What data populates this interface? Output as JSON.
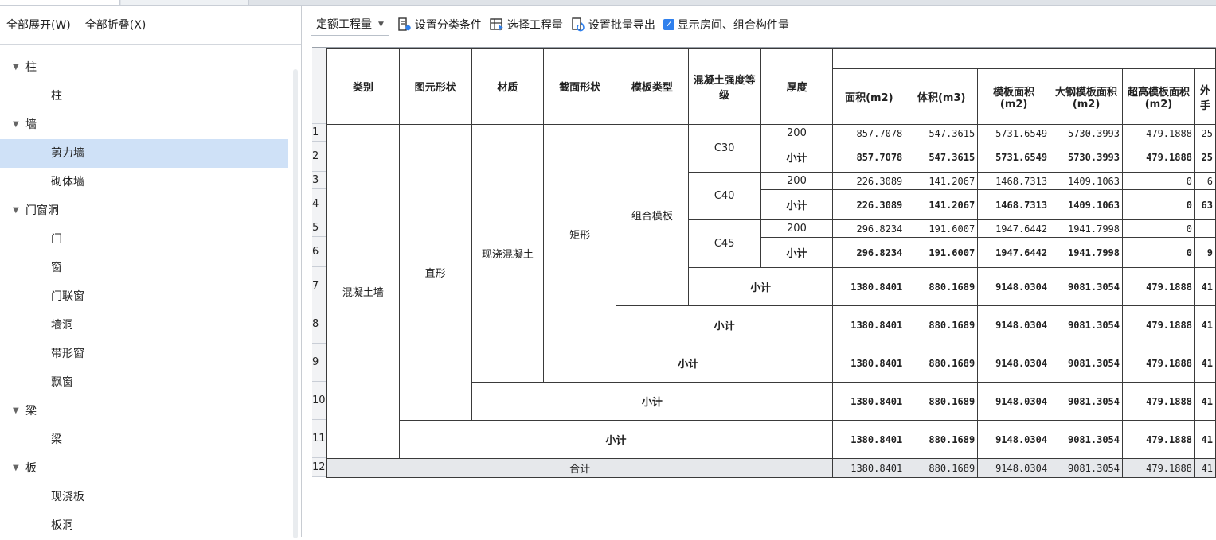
{
  "left_toolbar": {
    "expand_all": "全部展开(W)",
    "collapse_all": "全部折叠(X)"
  },
  "tree": [
    {
      "type": "group",
      "label": "柱"
    },
    {
      "type": "leaf",
      "label": "柱"
    },
    {
      "type": "group",
      "label": "墙"
    },
    {
      "type": "leaf",
      "label": "剪力墙",
      "selected": true
    },
    {
      "type": "leaf",
      "label": "砌体墙"
    },
    {
      "type": "group",
      "label": "门窗洞"
    },
    {
      "type": "leaf",
      "label": "门"
    },
    {
      "type": "leaf",
      "label": "窗"
    },
    {
      "type": "leaf",
      "label": "门联窗"
    },
    {
      "type": "leaf",
      "label": "墙洞"
    },
    {
      "type": "leaf",
      "label": "带形窗"
    },
    {
      "type": "leaf",
      "label": "飘窗"
    },
    {
      "type": "group",
      "label": "梁"
    },
    {
      "type": "leaf",
      "label": "梁"
    },
    {
      "type": "group",
      "label": "板"
    },
    {
      "type": "leaf",
      "label": "现浇板"
    },
    {
      "type": "leaf",
      "label": "板洞"
    }
  ],
  "toolbar": {
    "dropdown_value": "定额工程量",
    "set_classify": "设置分类条件",
    "select_qty": "选择工程量",
    "batch_export": "设置批量导出",
    "show_room": "显示房间、组合构件量",
    "show_room_checked": true
  },
  "table": {
    "headers": {
      "category": "类别",
      "shape": "图元形状",
      "material": "材质",
      "section": "截面形状",
      "formwork": "模板类型",
      "grade": "混凝土强度等级",
      "thickness": "厚度",
      "area": "面积(m2)",
      "volume": "体积(m3)",
      "form_area": "模板面积(m2)",
      "steel_form": "大钢模板面积(m2)",
      "high_form": "超高模板面积(m2)",
      "ext": "外手"
    },
    "row_numbers": [
      "1",
      "2",
      "3",
      "4",
      "5",
      "6",
      "7",
      "8",
      "9",
      "10",
      "11",
      "12"
    ],
    "category": "混凝土墙",
    "shape": "直形",
    "material": "现浇混凝土",
    "section": "矩形",
    "formwork": "组合模板",
    "subtotal": "小计",
    "total": "合计",
    "groups": [
      {
        "grade": "C30",
        "detail": {
          "thickness": "200",
          "area": "857.7078",
          "volume": "547.3615",
          "form_area": "5731.6549",
          "steel_form": "5730.3993",
          "high_form": "479.1888",
          "ext": "25"
        },
        "sub": {
          "area": "857.7078",
          "volume": "547.3615",
          "form_area": "5731.6549",
          "steel_form": "5730.3993",
          "high_form": "479.1888",
          "ext": "25"
        }
      },
      {
        "grade": "C40",
        "detail": {
          "thickness": "200",
          "area": "226.3089",
          "volume": "141.2067",
          "form_area": "1468.7313",
          "steel_form": "1409.1063",
          "high_form": "0",
          "ext": "6"
        },
        "sub": {
          "area": "226.3089",
          "volume": "141.2067",
          "form_area": "1468.7313",
          "steel_form": "1409.1063",
          "high_form": "0",
          "ext": "63"
        }
      },
      {
        "grade": "C45",
        "detail": {
          "thickness": "200",
          "area": "296.8234",
          "volume": "191.6007",
          "form_area": "1947.6442",
          "steel_form": "1941.7998",
          "high_form": "0",
          "ext": ""
        },
        "sub": {
          "area": "296.8234",
          "volume": "191.6007",
          "form_area": "1947.6442",
          "steel_form": "1941.7998",
          "high_form": "0",
          "ext": "9"
        }
      }
    ],
    "rollup": {
      "area": "1380.8401",
      "volume": "880.1689",
      "form_area": "9148.0304",
      "steel_form": "9081.3054",
      "high_form": "479.1888",
      "ext": "41"
    },
    "grand": {
      "area": "1380.8401",
      "volume": "880.1689",
      "form_area": "9148.0304",
      "steel_form": "9081.3054",
      "high_form": "479.1888",
      "ext": "41"
    }
  }
}
